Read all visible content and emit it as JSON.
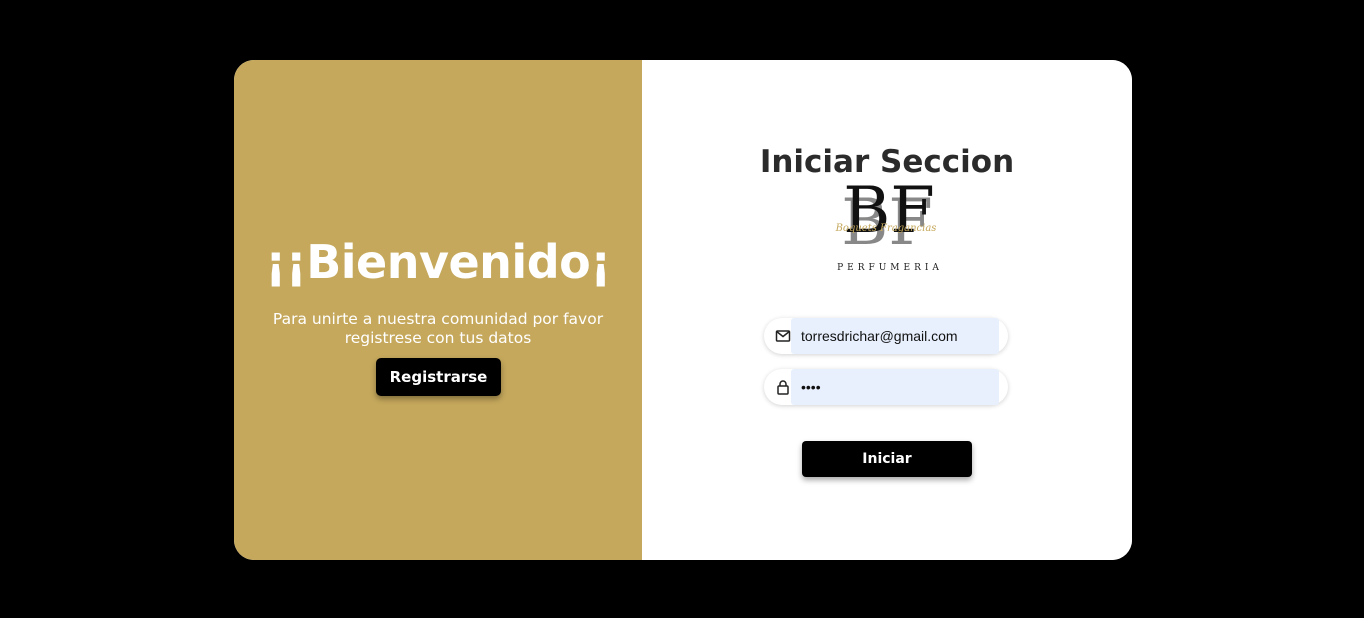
{
  "welcome": {
    "title": "¡¡Bienvenido¡",
    "message": "Para unirte a nuestra comunidad por favor registrese con tus datos",
    "register_label": "Registrarse"
  },
  "login": {
    "title": "Iniciar Seccion",
    "logo": {
      "letters": "BF",
      "script": "Boquets Fragancias",
      "subtitle": "PERFUMERIA"
    },
    "email": {
      "value": "torresdrichar@gmail.com",
      "icon": "mail-icon"
    },
    "password": {
      "value": "1234",
      "icon": "lock-icon"
    },
    "submit_label": "Iniciar"
  },
  "colors": {
    "background": "#000000",
    "accent_gold": "#c5a85c",
    "button": "#000000",
    "autofill": "#e8f0fe"
  }
}
